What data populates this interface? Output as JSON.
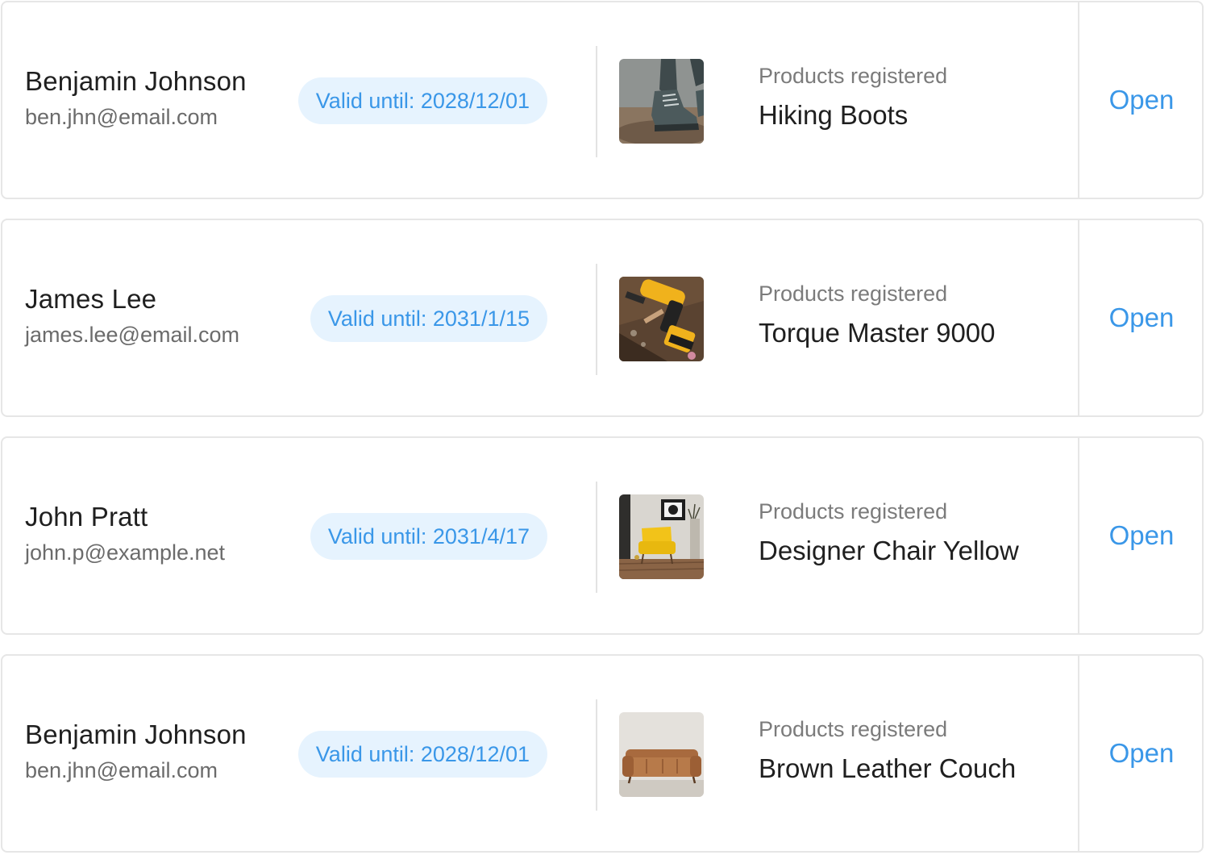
{
  "registrations": [
    {
      "name": "Benjamin Johnson",
      "email": "ben.jhn@email.com",
      "validity": "Valid until: 2028/12/01",
      "product_caption": "Products registered",
      "product_name": "Hiking Boots",
      "product_image": "hiking-boots-photo",
      "action_label": "Open"
    },
    {
      "name": "James Lee",
      "email": "james.lee@email.com",
      "validity": "Valid until: 2031/1/15",
      "product_caption": "Products registered",
      "product_name": "Torque Master 9000",
      "product_image": "power-drill-photo",
      "action_label": "Open"
    },
    {
      "name": "John Pratt",
      "email": "john.p@example.net",
      "validity": "Valid until: 2031/4/17",
      "product_caption": "Products registered",
      "product_name": "Designer Chair Yellow",
      "product_image": "yellow-armchair-photo",
      "action_label": "Open"
    },
    {
      "name": "Benjamin Johnson",
      "email": "ben.jhn@email.com",
      "validity": "Valid until: 2028/12/01",
      "product_caption": "Products registered",
      "product_name": "Brown Leather Couch",
      "product_image": "leather-couch-photo",
      "action_label": "Open"
    }
  ],
  "colors": {
    "accent": "#3a97e8",
    "badge_bg": "#e6f3fe",
    "border": "#e6e6e6",
    "text_primary": "#1f1f1f",
    "text_secondary": "#6b6b6b"
  }
}
